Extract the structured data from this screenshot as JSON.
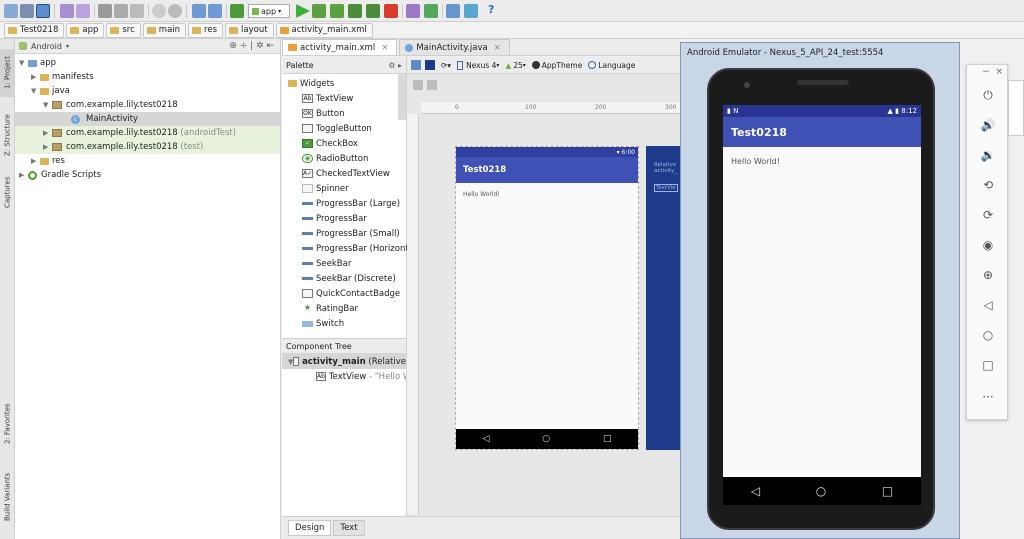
{
  "breadcrumbs": [
    "Test0218",
    "app",
    "src",
    "main",
    "res",
    "layout",
    "activity_main.xml"
  ],
  "toolbar": {
    "run_config": "app"
  },
  "left_strip": [
    "1: Project",
    "Z: Structure",
    "Captures",
    "2: Favorites",
    "Build Variants"
  ],
  "project": {
    "view_selector": "Android",
    "tree": [
      {
        "label": "app",
        "suffix": ""
      },
      {
        "label": "manifests",
        "suffix": ""
      },
      {
        "label": "java",
        "suffix": ""
      },
      {
        "label": "com.example.lily.test0218",
        "suffix": ""
      },
      {
        "label": "MainActivity",
        "suffix": ""
      },
      {
        "label": "com.example.lily.test0218",
        "suffix": "(androidTest)"
      },
      {
        "label": "com.example.lily.test0218",
        "suffix": "(test)"
      },
      {
        "label": "res",
        "suffix": ""
      },
      {
        "label": "Gradle Scripts",
        "suffix": ""
      }
    ]
  },
  "editor_tabs": [
    "activity_main.xml",
    "MainActivity.java"
  ],
  "palette": {
    "title": "Palette",
    "group": "Widgets",
    "items": [
      {
        "label": "TextView",
        "icon": "Ab"
      },
      {
        "label": "Button",
        "icon": "OK"
      },
      {
        "label": "ToggleButton",
        "icon": ""
      },
      {
        "label": "CheckBox",
        "icon": "✓"
      },
      {
        "label": "RadioButton",
        "icon": "◉"
      },
      {
        "label": "CheckedTextView",
        "icon": "A✓"
      },
      {
        "label": "Spinner",
        "icon": ""
      },
      {
        "label": "ProgressBar (Large)",
        "icon": ""
      },
      {
        "label": "ProgressBar",
        "icon": ""
      },
      {
        "label": "ProgressBar (Small)",
        "icon": ""
      },
      {
        "label": "ProgressBar (Horizonta",
        "icon": ""
      },
      {
        "label": "SeekBar",
        "icon": ""
      },
      {
        "label": "SeekBar (Discrete)",
        "icon": ""
      },
      {
        "label": "QuickContactBadge",
        "icon": ""
      },
      {
        "label": "RatingBar",
        "icon": "★"
      },
      {
        "label": "Switch",
        "icon": ""
      }
    ]
  },
  "component_tree": {
    "title": "Component Tree",
    "root": "activity_main",
    "root_suffix": "(Relative",
    "child": "TextView",
    "child_suffix": "- \"Hello W"
  },
  "design_toolbar": {
    "device": "Nexus 4",
    "api": "25",
    "theme": "AppTheme",
    "language": "Language"
  },
  "ruler": [
    "0",
    "100",
    "200",
    "300"
  ],
  "preview": {
    "time": "6:00",
    "app_title": "Test0218",
    "body_text": "Hello World!",
    "blueprint_line1": "Relative",
    "blueprint_line2": "activity_",
    "blueprint_widget": "TextVie"
  },
  "bottom_tabs": [
    "Design",
    "Text"
  ],
  "emulator": {
    "title": "Android Emulator - Nexus_5_API_24_test:5554",
    "time": "8:12",
    "app_title": "Test0218",
    "body_text": "Hello World!"
  },
  "colors": {
    "primary": "#3f51b5",
    "primary_dark": "#283593",
    "blueprint": "#1e3a8a"
  }
}
